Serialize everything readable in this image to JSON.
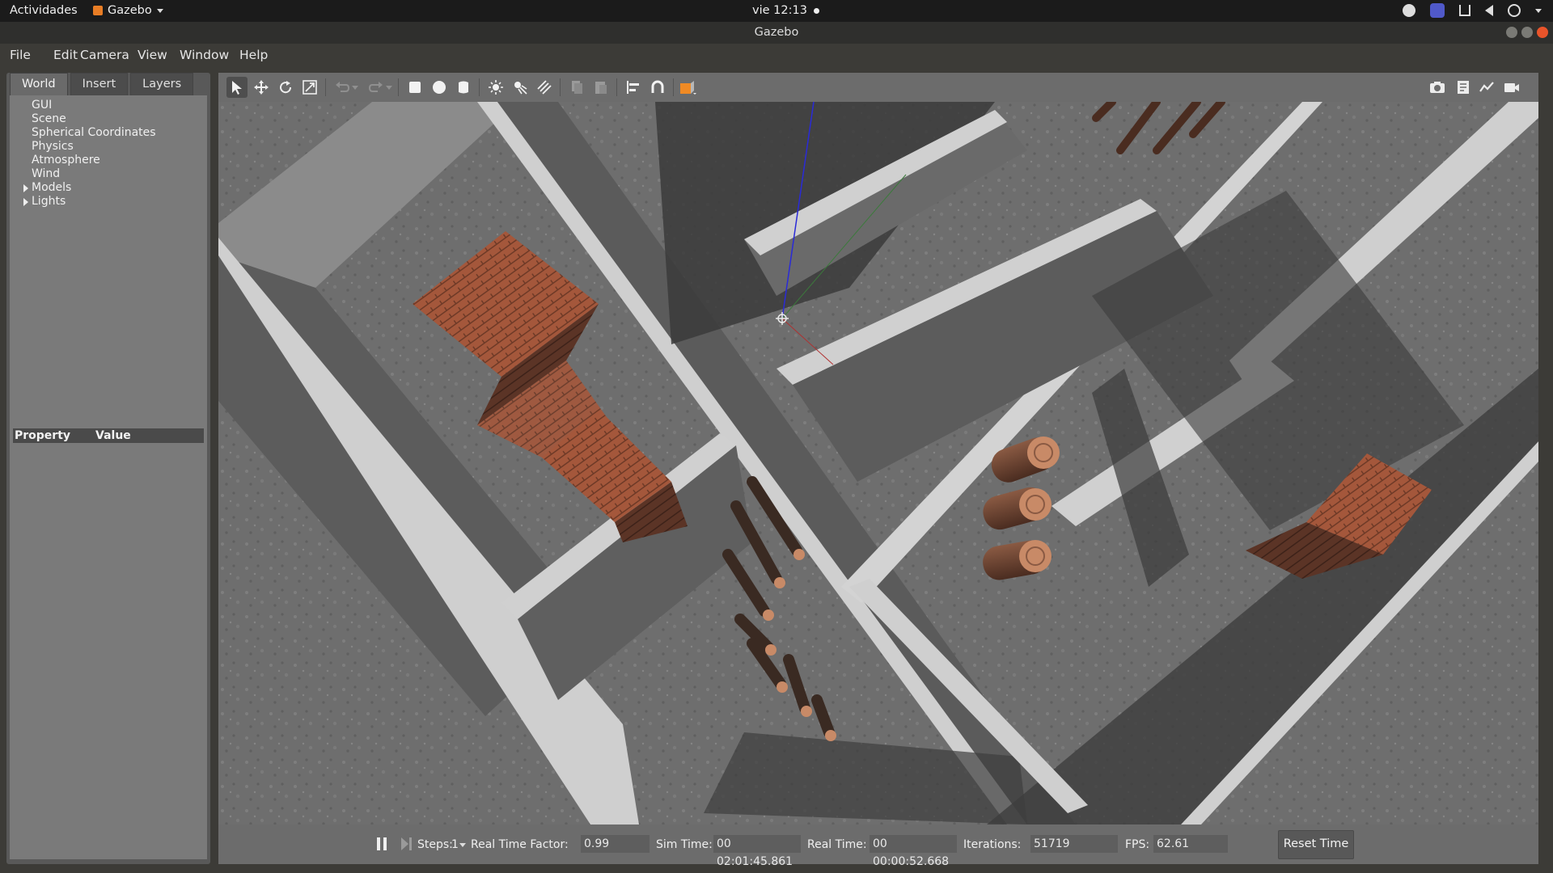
{
  "topbar": {
    "activities": "Actividades",
    "app_name": "Gazebo",
    "clock": "vie 12:13"
  },
  "window": {
    "title": "Gazebo"
  },
  "menu": [
    "File",
    "Edit",
    "Camera",
    "View",
    "Window",
    "Help"
  ],
  "left_panel": {
    "tabs": [
      "World",
      "Insert",
      "Layers"
    ],
    "active_tab": "World",
    "tree": [
      "GUI",
      "Scene",
      "Spherical Coordinates",
      "Physics",
      "Atmosphere",
      "Wind",
      "Models",
      "Lights"
    ],
    "expandable": [
      "Models",
      "Lights"
    ],
    "property_headers": {
      "property": "Property",
      "value": "Value"
    }
  },
  "toolbar": {
    "left_tools": [
      "select-mode-icon",
      "translate-mode-icon",
      "rotate-mode-icon",
      "scale-mode-icon",
      "undo-icon",
      "undo-history-icon",
      "redo-icon",
      "redo-history-icon",
      "box-shape-icon",
      "sphere-shape-icon",
      "cylinder-shape-icon",
      "point-light-icon",
      "spot-light-icon",
      "directional-light-icon",
      "copy-icon",
      "paste-icon",
      "align-icon",
      "snap-icon",
      "view-angle-icon"
    ],
    "right_tools": [
      "screenshot-icon",
      "log-data-icon",
      "plot-icon",
      "video-record-icon"
    ]
  },
  "bottom_bar": {
    "steps_label": "Steps:",
    "steps_value": "1",
    "rtf_label": "Real Time Factor:",
    "rtf_value": "0.99",
    "sim_time_label": "Sim Time:",
    "sim_time_value": "00 02:01:45.861",
    "real_time_label": "Real Time:",
    "real_time_value": "00 00:00:52.668",
    "iterations_label": "Iterations:",
    "iterations_value": "51719",
    "fps_label": "FPS:",
    "fps_value": "62.61",
    "reset_label": "Reset Time"
  },
  "colors": {
    "accent": "#e9542a",
    "floor": "#6f6f6f",
    "wall_top": "#cfcfcf",
    "wood": "#a4573b"
  }
}
